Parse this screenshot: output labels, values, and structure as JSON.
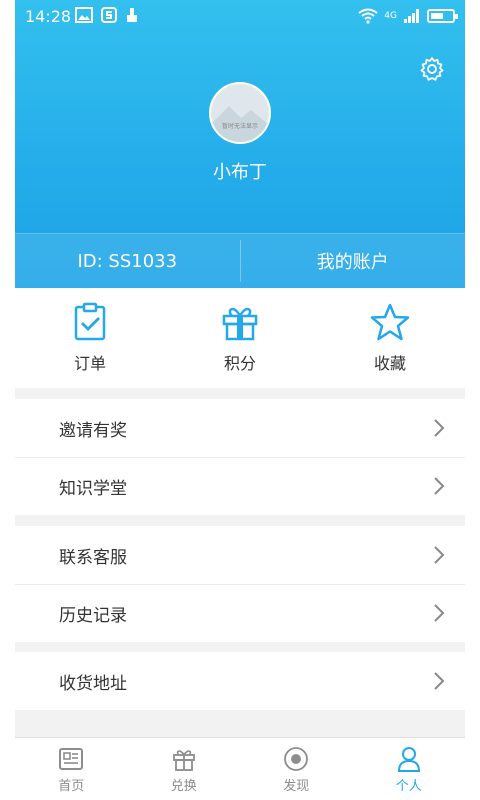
{
  "status_bar": {
    "time": "14:28",
    "network": "4G",
    "icons": [
      "image-icon",
      "s-app-icon",
      "brush-icon",
      "wifi-icon",
      "signal-icon",
      "battery-icon"
    ]
  },
  "header": {
    "avatar_caption": "暂时无法显示",
    "username": "小布丁",
    "user_id": "ID: SS1033",
    "account_link": "我的账户",
    "gradient_colors": [
      "#33c0ee",
      "#1aa2e6"
    ]
  },
  "quick_actions": [
    {
      "label": "订单",
      "icon": "clipboard-check-icon"
    },
    {
      "label": "积分",
      "icon": "gift-icon"
    },
    {
      "label": "收藏",
      "icon": "star-icon"
    }
  ],
  "menu_groups": [
    [
      {
        "label": "邀请有奖"
      },
      {
        "label": "知识学堂"
      }
    ],
    [
      {
        "label": "联系客服"
      },
      {
        "label": "历史记录"
      }
    ],
    [
      {
        "label": "收货地址"
      }
    ]
  ],
  "bottom_nav": [
    {
      "label": "首页",
      "icon": "home-card-icon",
      "active": false
    },
    {
      "label": "兑换",
      "icon": "gift-outline-icon",
      "active": false
    },
    {
      "label": "发现",
      "icon": "discover-icon",
      "active": false
    },
    {
      "label": "个人",
      "icon": "person-icon",
      "active": true
    }
  ],
  "colors": {
    "accent": "#24a8ea",
    "background": "#f2f2f2"
  }
}
